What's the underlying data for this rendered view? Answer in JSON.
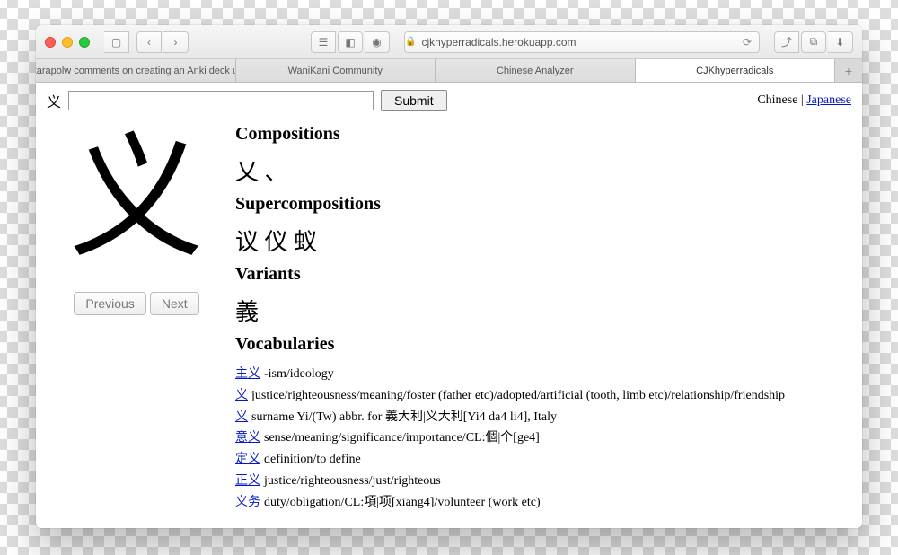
{
  "browser": {
    "url": "cjkhyperradicals.herokuapp.com",
    "tabs": [
      "patarapolw comments on creating an Anki deck u…",
      "WaniKani Community",
      "Chinese Analyzer",
      "CJKhyperradicals"
    ]
  },
  "search": {
    "prefix_char": "义",
    "value": "",
    "submit_label": "Submit"
  },
  "langlinks": {
    "text": "Chinese",
    "sep": " | ",
    "link": "Japanese"
  },
  "glyph": "义",
  "nav": {
    "prev": "Previous",
    "next": "Next"
  },
  "sections": {
    "compositions": {
      "title": "Compositions",
      "chars": "乂 、"
    },
    "supercompositions": {
      "title": "Supercompositions",
      "chars": "议 仪 蚁"
    },
    "variants": {
      "title": "Variants",
      "chars": "義"
    },
    "vocabularies": {
      "title": "Vocabularies",
      "items": [
        {
          "term": "主义",
          "def": "-ism/ideology"
        },
        {
          "term": "义",
          "def": "justice/righteousness/meaning/foster (father etc)/adopted/artificial (tooth, limb etc)/relationship/friendship"
        },
        {
          "term": "义",
          "def": "surname Yi/(Tw) abbr. for 義大利|义大利[Yi4 da4 li4], Italy"
        },
        {
          "term": "意义",
          "def": "sense/meaning/significance/importance/CL:個|个[ge4]"
        },
        {
          "term": "定义",
          "def": "definition/to define"
        },
        {
          "term": "正义",
          "def": "justice/righteousness/just/righteous"
        },
        {
          "term": "义务",
          "def": "duty/obligation/CL:項|项[xiang4]/volunteer (work etc)"
        }
      ]
    }
  }
}
